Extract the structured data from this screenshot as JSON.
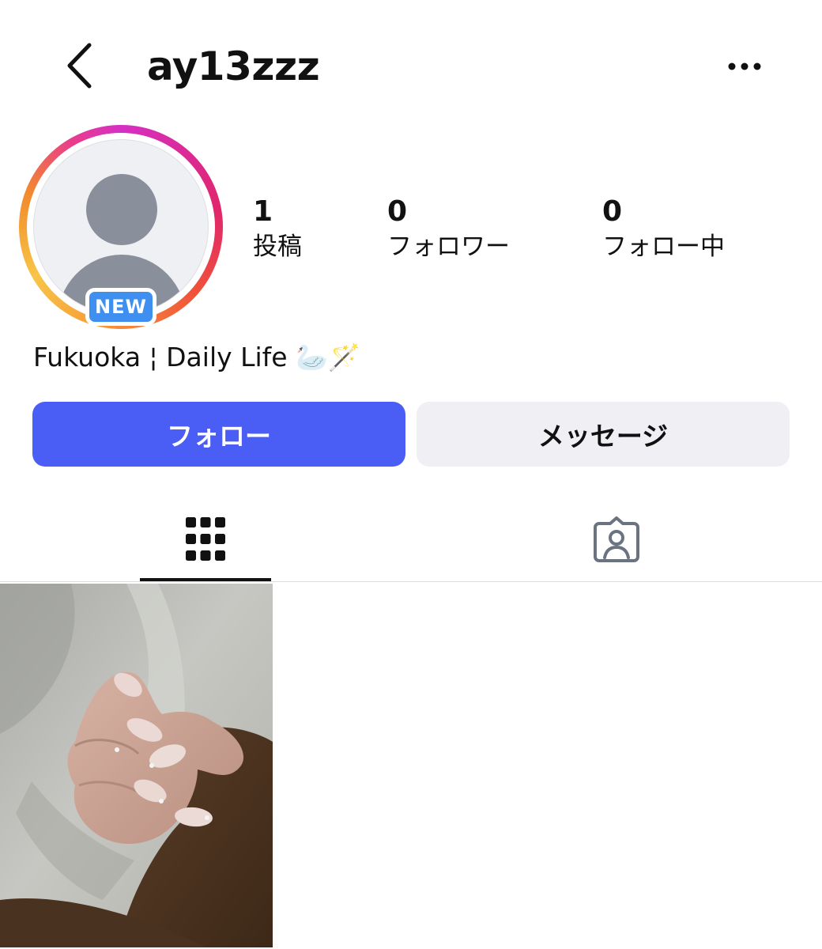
{
  "header": {
    "username": "ay13zzz",
    "back_icon": "chevron-left-icon",
    "more_icon": "ellipsis-horizontal-icon"
  },
  "profile": {
    "avatar_badge": "NEW",
    "avatar_icon": "default-person-icon",
    "bio": "Fukuoka ¦ Daily Life 🦢🪄"
  },
  "stats": [
    {
      "value": "1",
      "label": "投稿"
    },
    {
      "value": "0",
      "label": "フォロワー"
    },
    {
      "value": "0",
      "label": "フォロー中"
    }
  ],
  "actions": {
    "follow_label": "フォロー",
    "message_label": "メッセージ"
  },
  "tabs": [
    {
      "icon": "grid-icon",
      "selected": true
    },
    {
      "icon": "tagged-person-icon",
      "selected": false
    }
  ],
  "colors": {
    "follow_button": "#4a5ef5",
    "message_button": "#efeff4",
    "new_badge": "#3f8ff0",
    "story_ring_start": "#d62fc4",
    "story_ring_end": "#f7c548"
  }
}
